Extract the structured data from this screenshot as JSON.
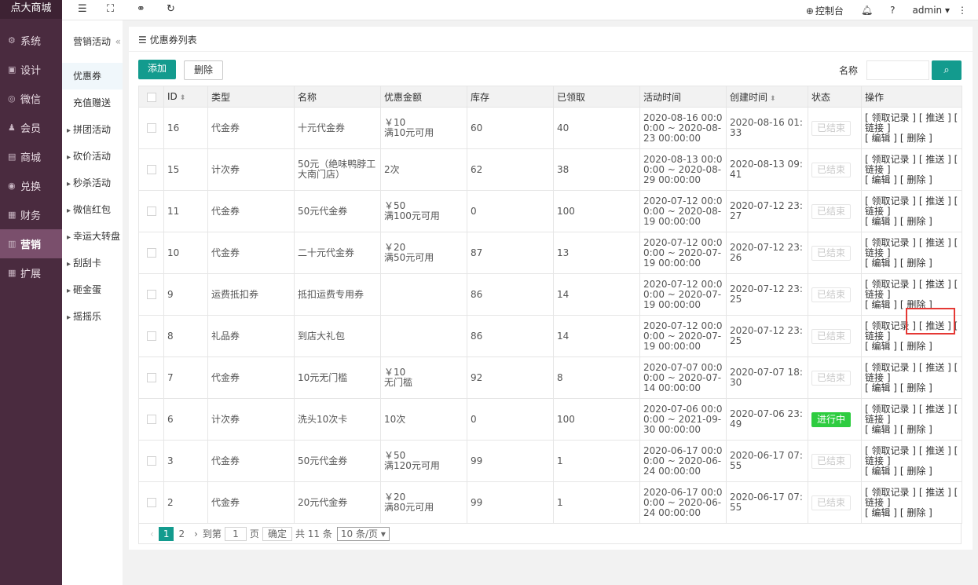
{
  "sidebar": {
    "logo": "点大商城",
    "items": [
      {
        "icon": "gear-icon",
        "label": "系统"
      },
      {
        "icon": "brush-icon",
        "label": "设计"
      },
      {
        "icon": "wechat-icon",
        "label": "微信"
      },
      {
        "icon": "user-icon",
        "label": "会员"
      },
      {
        "icon": "store-icon",
        "label": "商城"
      },
      {
        "icon": "exchange-icon",
        "label": "兑换"
      },
      {
        "icon": "finance-icon",
        "label": "财务"
      },
      {
        "icon": "gift-icon",
        "label": "营销"
      },
      {
        "icon": "grid-icon",
        "label": "扩展"
      }
    ]
  },
  "topbar": {
    "console": "控制台",
    "user": "admin"
  },
  "subnav": {
    "heading": "营销活动",
    "items": [
      "优惠券",
      "充值赠送",
      "拼团活动",
      "砍价活动",
      "秒杀活动",
      "微信红包",
      "幸运大转盘",
      "刮刮卡",
      "砸金蛋",
      "摇摇乐"
    ]
  },
  "page": {
    "title": "优惠券列表",
    "add_button": "添加",
    "delete_button": "删除",
    "search_label": "名称",
    "search_value": ""
  },
  "table": {
    "headers": [
      "ID",
      "类型",
      "名称",
      "优惠金额",
      "库存",
      "已领取",
      "活动时间",
      "创建时间",
      "状态",
      "操作"
    ],
    "rows": [
      {
        "id": "16",
        "type": "代金券",
        "name": "十元代金券",
        "amount1": "￥10",
        "amount2": "满10元可用",
        "stock": "60",
        "received": "40",
        "time": "2020-08-16 00:00:00 ~ 2020-08-23 00:00:00",
        "created": "2020-08-16 01:33",
        "status": "已结束"
      },
      {
        "id": "15",
        "type": "计次券",
        "name": "50元（绝味鸭脖工大南门店）",
        "amount1": "2次",
        "amount2": "",
        "stock": "62",
        "received": "38",
        "time": "2020-08-13 00:00:00 ~ 2020-08-29 00:00:00",
        "created": "2020-08-13 09:41",
        "status": "已结束"
      },
      {
        "id": "11",
        "type": "代金券",
        "name": "50元代金券",
        "amount1": "￥50",
        "amount2": "满100元可用",
        "stock": "0",
        "received": "100",
        "time": "2020-07-12 00:00:00 ~ 2020-08-19 00:00:00",
        "created": "2020-07-12 23:27",
        "status": "已结束"
      },
      {
        "id": "10",
        "type": "代金券",
        "name": "二十元代金券",
        "amount1": "￥20",
        "amount2": "满50元可用",
        "stock": "87",
        "received": "13",
        "time": "2020-07-12 00:00:00 ~ 2020-07-19 00:00:00",
        "created": "2020-07-12 23:26",
        "status": "已结束"
      },
      {
        "id": "9",
        "type": "运费抵扣券",
        "name": "抵扣运费专用券",
        "amount1": "",
        "amount2": "",
        "stock": "86",
        "received": "14",
        "time": "2020-07-12 00:00:00 ~ 2020-07-19 00:00:00",
        "created": "2020-07-12 23:25",
        "status": "已结束"
      },
      {
        "id": "8",
        "type": "礼品券",
        "name": "到店大礼包",
        "amount1": "",
        "amount2": "",
        "stock": "86",
        "received": "14",
        "time": "2020-07-12 00:00:00 ~ 2020-07-19 00:00:00",
        "created": "2020-07-12 23:25",
        "status": "已结束"
      },
      {
        "id": "7",
        "type": "代金券",
        "name": "10元无门槛",
        "amount1": "￥10",
        "amount2": "无门槛",
        "stock": "92",
        "received": "8",
        "time": "2020-07-07 00:00:00 ~ 2020-07-14 00:00:00",
        "created": "2020-07-07 18:30",
        "status": "已结束"
      },
      {
        "id": "6",
        "type": "计次券",
        "name": "洗头10次卡",
        "amount1": "10次",
        "amount2": "",
        "stock": "0",
        "received": "100",
        "time": "2020-07-06 00:00:00 ~ 2021-09-30 00:00:00",
        "created": "2020-07-06 23:49",
        "status": "进行中"
      },
      {
        "id": "3",
        "type": "代金券",
        "name": "50元代金券",
        "amount1": "￥50",
        "amount2": "满120元可用",
        "stock": "99",
        "received": "1",
        "time": "2020-06-17 00:00:00 ~ 2020-06-24 00:00:00",
        "created": "2020-06-17 07:55",
        "status": "已结束"
      },
      {
        "id": "2",
        "type": "代金券",
        "name": "20元代金券",
        "amount1": "￥20",
        "amount2": "满80元可用",
        "stock": "99",
        "received": "1",
        "time": "2020-06-17 00:00:00 ~ 2020-06-24 00:00:00",
        "created": "2020-06-17 07:55",
        "status": "已结束"
      }
    ],
    "ops": {
      "records": "[ 领取记录 ]",
      "push": "[ 推送 ]",
      "link": "[ 链接 ]",
      "edit": "[ 编辑 ]",
      "delete": "[ 删除 ]"
    }
  },
  "pager": {
    "pages": [
      "1",
      "2"
    ],
    "goto": "到第",
    "goto_value": "1",
    "page_unit": "页",
    "confirm": "确定",
    "total": "共 11 条",
    "page_size": "10 条/页"
  },
  "colors": {
    "primary": "#139b8e",
    "sidebar": "#4a2b3f",
    "running": "#2ecc40",
    "highlight": "#e53935"
  }
}
